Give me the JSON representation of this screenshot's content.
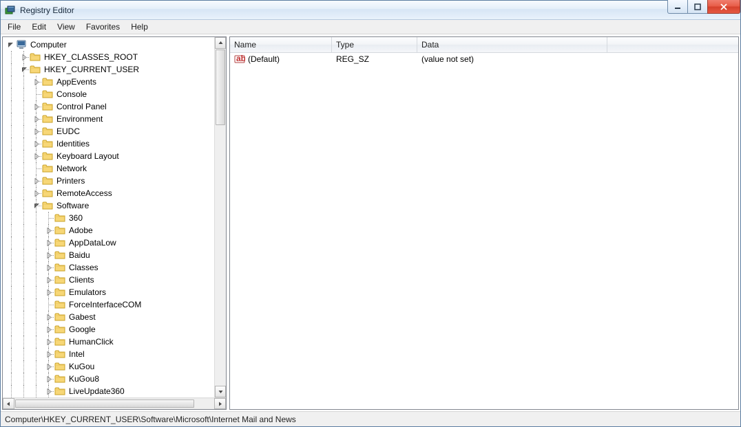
{
  "window": {
    "title": "Registry Editor"
  },
  "menu": {
    "items": [
      "File",
      "Edit",
      "View",
      "Favorites",
      "Help"
    ]
  },
  "tree": {
    "root_label": "Computer",
    "items": [
      {
        "depth": 0,
        "expand": "closed",
        "icon": "folder",
        "label": "HKEY_CLASSES_ROOT"
      },
      {
        "depth": 0,
        "expand": "open",
        "icon": "folder",
        "label": "HKEY_CURRENT_USER"
      },
      {
        "depth": 1,
        "expand": "closed",
        "icon": "folder",
        "label": "AppEvents"
      },
      {
        "depth": 1,
        "expand": "none",
        "icon": "folder",
        "label": "Console"
      },
      {
        "depth": 1,
        "expand": "closed",
        "icon": "folder",
        "label": "Control Panel"
      },
      {
        "depth": 1,
        "expand": "closed",
        "icon": "folder",
        "label": "Environment"
      },
      {
        "depth": 1,
        "expand": "closed",
        "icon": "folder",
        "label": "EUDC"
      },
      {
        "depth": 1,
        "expand": "closed",
        "icon": "folder",
        "label": "Identities"
      },
      {
        "depth": 1,
        "expand": "closed",
        "icon": "folder",
        "label": "Keyboard Layout"
      },
      {
        "depth": 1,
        "expand": "none",
        "icon": "folder",
        "label": "Network"
      },
      {
        "depth": 1,
        "expand": "closed",
        "icon": "folder",
        "label": "Printers"
      },
      {
        "depth": 1,
        "expand": "closed",
        "icon": "folder",
        "label": "RemoteAccess"
      },
      {
        "depth": 1,
        "expand": "open",
        "icon": "folder",
        "label": "Software"
      },
      {
        "depth": 2,
        "expand": "none",
        "icon": "folder",
        "label": "360"
      },
      {
        "depth": 2,
        "expand": "closed",
        "icon": "folder",
        "label": "Adobe"
      },
      {
        "depth": 2,
        "expand": "closed",
        "icon": "folder",
        "label": "AppDataLow"
      },
      {
        "depth": 2,
        "expand": "closed",
        "icon": "folder",
        "label": "Baidu"
      },
      {
        "depth": 2,
        "expand": "closed",
        "icon": "folder",
        "label": "Classes"
      },
      {
        "depth": 2,
        "expand": "closed",
        "icon": "folder",
        "label": "Clients"
      },
      {
        "depth": 2,
        "expand": "closed",
        "icon": "folder",
        "label": "Emulators"
      },
      {
        "depth": 2,
        "expand": "none",
        "icon": "folder",
        "label": "ForceInterfaceCOM"
      },
      {
        "depth": 2,
        "expand": "closed",
        "icon": "folder",
        "label": "Gabest"
      },
      {
        "depth": 2,
        "expand": "closed",
        "icon": "folder",
        "label": "Google"
      },
      {
        "depth": 2,
        "expand": "closed",
        "icon": "folder",
        "label": "HumanClick"
      },
      {
        "depth": 2,
        "expand": "closed",
        "icon": "folder",
        "label": "Intel"
      },
      {
        "depth": 2,
        "expand": "closed",
        "icon": "folder",
        "label": "KuGou"
      },
      {
        "depth": 2,
        "expand": "closed",
        "icon": "folder",
        "label": "KuGou8"
      },
      {
        "depth": 2,
        "expand": "closed",
        "icon": "folder",
        "label": "LiveUpdate360"
      }
    ]
  },
  "list": {
    "columns": {
      "name": "Name",
      "type": "Type",
      "data": "Data"
    },
    "rows": [
      {
        "name": "(Default)",
        "type": "REG_SZ",
        "data": "(value not set)"
      }
    ]
  },
  "statusbar": {
    "path": "Computer\\HKEY_CURRENT_USER\\Software\\Microsoft\\Internet Mail and News"
  }
}
